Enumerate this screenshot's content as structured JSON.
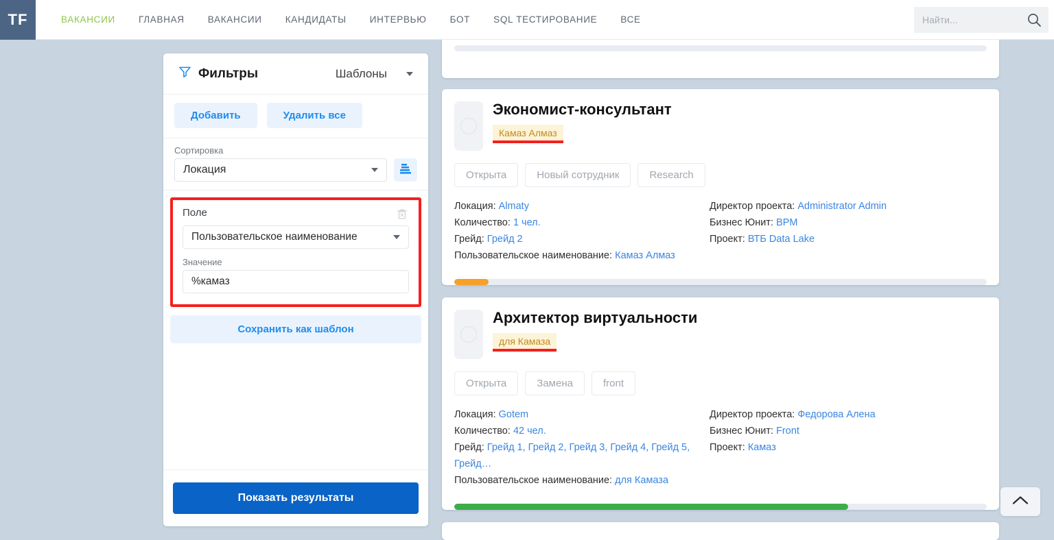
{
  "header": {
    "logo_text": "TF",
    "nav": [
      {
        "label": "ВАКАНСИИ",
        "active": true
      },
      {
        "label": "ГЛАВНАЯ",
        "active": false
      },
      {
        "label": "ВАКАНСИИ",
        "active": false
      },
      {
        "label": "КАНДИДАТЫ",
        "active": false
      },
      {
        "label": "ИНТЕРВЬЮ",
        "active": false
      },
      {
        "label": "БОТ",
        "active": false
      },
      {
        "label": "SQL ТЕСТИРОВАНИЕ",
        "active": false
      },
      {
        "label": "ВСЕ",
        "active": false
      }
    ],
    "search": {
      "value": "",
      "placeholder": "Найти...",
      "icon": "search-icon"
    }
  },
  "filters": {
    "title": "Фильтры",
    "title_icon": "filter-funnel-icon",
    "templates_label": "Шаблоны",
    "templates_caret_icon": "chevron-down-icon",
    "add_label": "Добавить",
    "delete_all_label": "Удалить все",
    "sort_label": "Сортировка",
    "sort_value": "Локация",
    "sort_caret_icon": "chevron-down-icon",
    "sort_order_icon": "sort-bars-icon",
    "rule": {
      "field_label": "Поле",
      "field_value": "Пользовательское наименование",
      "field_caret_icon": "chevron-down-icon",
      "delete_icon": "trash-delete-icon",
      "value_label": "Значение",
      "value_value": "%камаз"
    },
    "save_template_label": "Сохранить как шаблон",
    "show_results_label": "Показать результаты"
  },
  "labels": {
    "location": "Локация:",
    "count": "Количество:",
    "grade": "Грейд:",
    "custom_name": "Пользовательское наименование:",
    "director": "Директор проекта:",
    "business_unit": "Бизнес Юнит:",
    "project": "Проект:"
  },
  "cards": [
    {
      "title": "Экономист-консультант",
      "badge": "Камаз Алмаз",
      "chips": [
        "Открыта",
        "Новый сотрудник",
        "Research"
      ],
      "location": "Almaty",
      "count": "1 чел.",
      "grade": "Грейд 2",
      "custom_name": "Камаз Алмаз",
      "director": "Administrator Admin",
      "business_unit": "BPM",
      "project": "ВТБ Data Lake",
      "progress_percent": 6.5,
      "progress_color": "#f5a02a"
    },
    {
      "title": "Архитектор виртуальности",
      "badge": "для Камаза",
      "chips": [
        "Открыта",
        "Замена",
        "front"
      ],
      "location": "Gotem",
      "count": "42 чел.",
      "grade": "Грейд 1, Грейд 2, Грейд 3, Грейд 4, Грейд 5, Грейд…",
      "custom_name": "для Камаза",
      "director": "Федорова Алена",
      "business_unit": "Front",
      "project": "Камаз",
      "progress_percent": 74,
      "progress_color": "#3cad48"
    }
  ],
  "scroll_top": {
    "icon": "chevron-up-icon"
  },
  "colors": {
    "accent_blue": "#0a63c6",
    "link_blue": "#3a86e0",
    "active_nav_green": "#8ec64a",
    "annotation_red": "#f51f1f",
    "badge_bg": "#fdf3d7",
    "badge_text": "#c08a1e"
  }
}
